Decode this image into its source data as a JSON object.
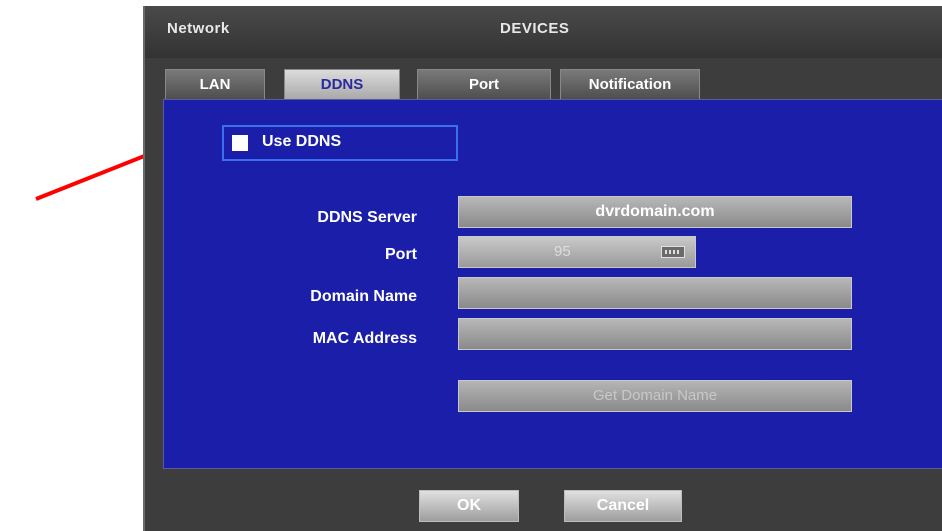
{
  "window": {
    "title_left": "Network",
    "title_center": "DEVICES"
  },
  "tabs": [
    {
      "label": "LAN",
      "active": false
    },
    {
      "label": "DDNS",
      "active": true
    },
    {
      "label": "Port",
      "active": false
    },
    {
      "label": "Notification",
      "active": false
    }
  ],
  "ddns": {
    "use_ddns_label": "Use DDNS",
    "use_ddns_checked": false,
    "server_label": "DDNS Server",
    "server_value": "dvrdomain.com",
    "port_label": "Port",
    "port_value": "95",
    "domain_name_label": "Domain Name",
    "domain_name_value": "",
    "mac_label": "MAC Address",
    "mac_value": "",
    "get_domain_label": "Get Domain Name"
  },
  "buttons": {
    "ok": "OK",
    "cancel": "Cancel"
  },
  "icons": {
    "keypad": "keypad-icon",
    "annotation_arrow": "red-arrow-icon"
  },
  "colors": {
    "panel": "#1a1ea8",
    "annotation_arrow": "#ff0000",
    "window_chrome": "#3d3d3d"
  }
}
